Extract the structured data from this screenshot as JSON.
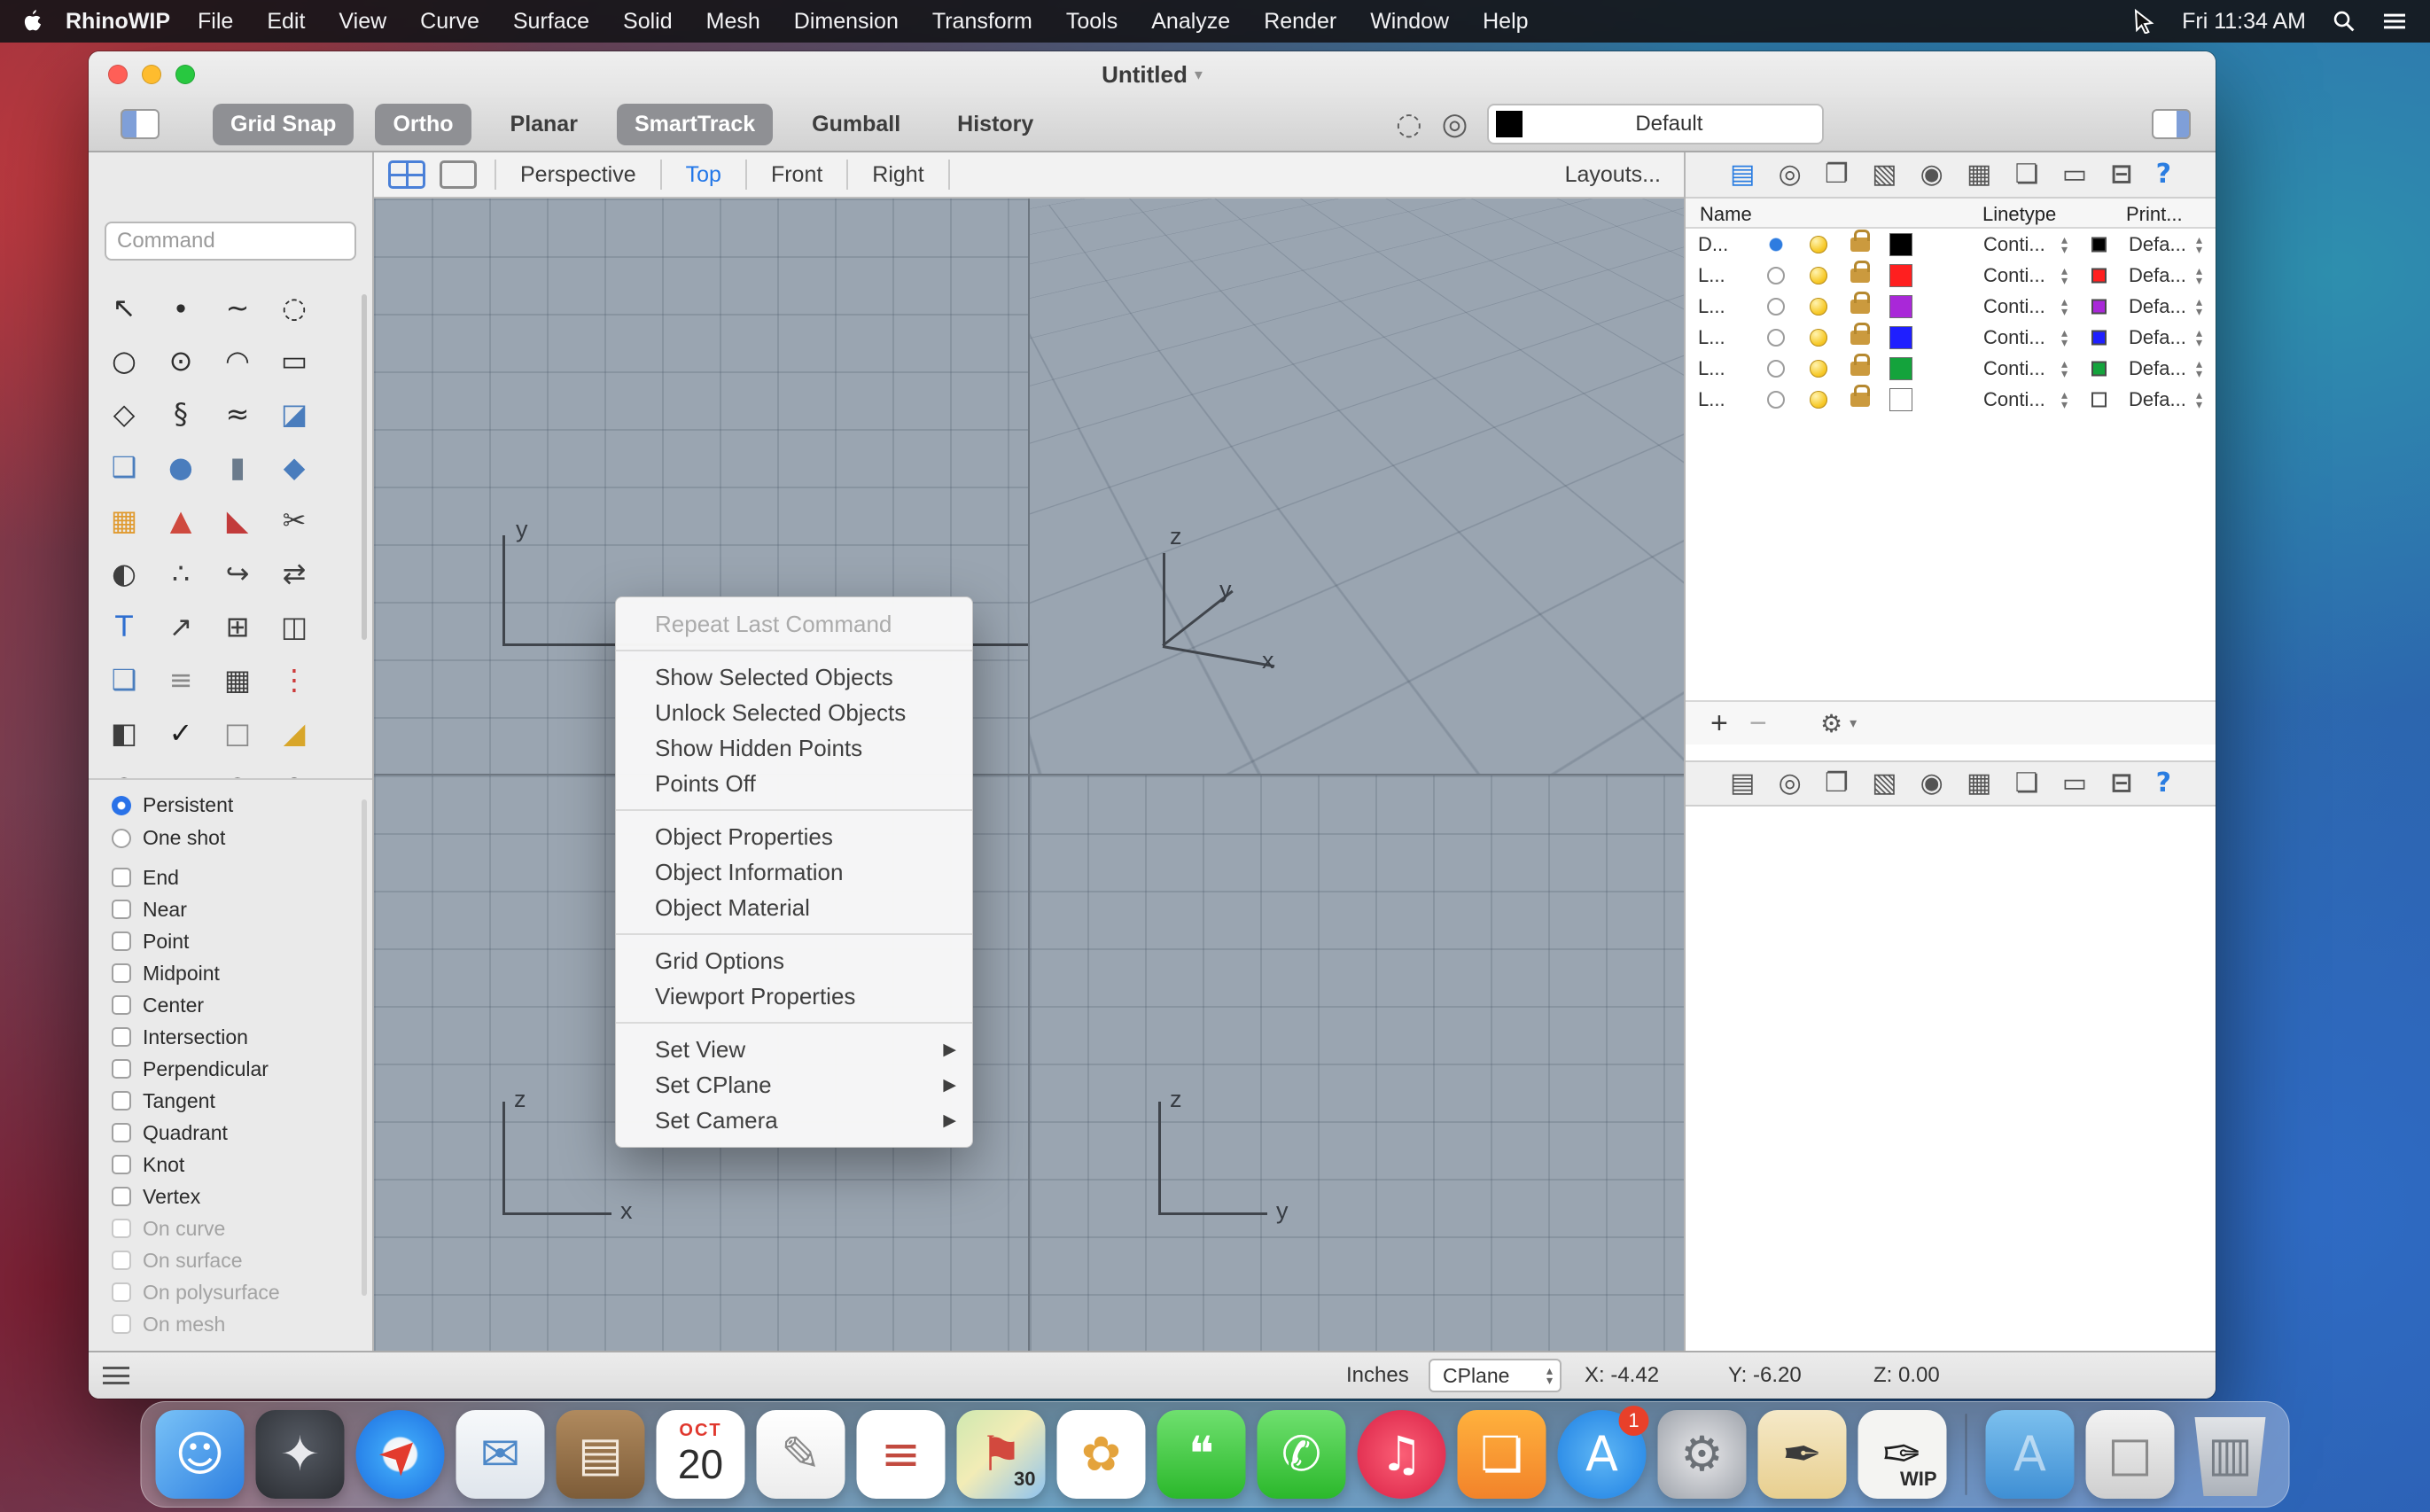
{
  "menubar": {
    "app_name": "RhinoWIP",
    "menus": [
      "File",
      "Edit",
      "View",
      "Curve",
      "Surface",
      "Solid",
      "Mesh",
      "Dimension",
      "Transform",
      "Tools",
      "Analyze",
      "Render",
      "Window",
      "Help"
    ],
    "clock": "Fri 11:34 AM",
    "status_icons": [
      "pointer-icon",
      "spotlight-search-icon",
      "notification-center-icon"
    ]
  },
  "window": {
    "title": "Untitled",
    "title_chevron": "▾",
    "toolbar": {
      "buttons": [
        {
          "label": "Grid Snap",
          "on": true
        },
        {
          "label": "Ortho",
          "on": true
        },
        {
          "label": "Planar",
          "on": false
        },
        {
          "label": "SmartTrack",
          "on": true
        },
        {
          "label": "Gumball",
          "on": false
        },
        {
          "label": "History",
          "on": false
        }
      ],
      "right_icons": [
        {
          "name": "snap-disc-icon",
          "glyph": "◌"
        },
        {
          "name": "target-circle-icon",
          "glyph": "◎"
        }
      ],
      "layer_selector": {
        "value": "Default",
        "swatch": "#000000"
      }
    },
    "viewport_bar": {
      "tabs": [
        {
          "label": "Perspective",
          "active": false
        },
        {
          "label": "Top",
          "active": true
        },
        {
          "label": "Front",
          "active": false
        },
        {
          "label": "Right",
          "active": false
        }
      ],
      "layouts": "Layouts..."
    },
    "sidebar": {
      "command_placeholder": "Command",
      "tools": [
        {
          "name": "select-arrow-tool",
          "glyph": "↖",
          "color": "#2e2e2e"
        },
        {
          "name": "point-tool",
          "glyph": "∙",
          "color": "#2e2e2e"
        },
        {
          "name": "control-point-curve-tool",
          "glyph": "~",
          "color": "#2e2e2e"
        },
        {
          "name": "lasso-tool",
          "glyph": "◌",
          "color": "#2e2e2e"
        },
        {
          "name": "circle-tool",
          "glyph": "○",
          "color": "#2e2e2e"
        },
        {
          "name": "ellipse-tool",
          "glyph": "⊙",
          "color": "#2e2e2e"
        },
        {
          "name": "arc-tool",
          "glyph": "◠",
          "color": "#2e2e2e"
        },
        {
          "name": "rectangle-tool",
          "glyph": "▭",
          "color": "#2e2e2e"
        },
        {
          "name": "polygon-tool",
          "glyph": "◇",
          "color": "#2e2e2e"
        },
        {
          "name": "helix-tool",
          "glyph": "§",
          "color": "#2e2e2e"
        },
        {
          "name": "freeform-curve-tool",
          "glyph": "≈",
          "color": "#2e2e2e"
        },
        {
          "name": "surface-tool",
          "glyph": "◪",
          "color": "#4a7dbd"
        },
        {
          "name": "box-tool",
          "glyph": "❑",
          "color": "#4a7dbd"
        },
        {
          "name": "sphere-tool",
          "glyph": "●",
          "color": "#4a7dbd"
        },
        {
          "name": "cylinder-tool",
          "glyph": "▮",
          "color": "#6b7b8c"
        },
        {
          "name": "plane-tool",
          "glyph": "◆",
          "color": "#4a7dbd"
        },
        {
          "name": "plugins-puzzle-tool",
          "glyph": "▦",
          "color": "#e09a2f"
        },
        {
          "name": "analyze-tool",
          "glyph": "▲",
          "color": "#cf4a3f"
        },
        {
          "name": "fillet-tool",
          "glyph": "◣",
          "color": "#c23b3b"
        },
        {
          "name": "trim-tool",
          "glyph": "✂",
          "color": "#3e3e3e"
        },
        {
          "name": "boolean-tool",
          "glyph": "◐",
          "color": "#3e3e3e"
        },
        {
          "name": "divide-tool",
          "glyph": "∴",
          "color": "#3e3e3e"
        },
        {
          "name": "blend-tool",
          "glyph": "↪",
          "color": "#3e3e3e"
        },
        {
          "name": "orient-tool",
          "glyph": "⇄",
          "color": "#3e3e3e"
        },
        {
          "name": "text-tool",
          "glyph": "T",
          "color": "#2f6fd0"
        },
        {
          "name": "move-tool",
          "glyph": "↗",
          "color": "#3e3e3e"
        },
        {
          "name": "copy-tool",
          "glyph": "⊞",
          "color": "#3e3e3e"
        },
        {
          "name": "mirror-tool",
          "glyph": "◫",
          "color": "#3e3e3e"
        },
        {
          "name": "extrude-tool",
          "glyph": "❑",
          "color": "#4a7dbd"
        },
        {
          "name": "point-grid-tool",
          "glyph": "≡",
          "color": "#8a8a8a"
        },
        {
          "name": "array-tool",
          "glyph": "▦",
          "color": "#3e3e3e"
        },
        {
          "name": "linear-array-tool",
          "glyph": "⋮",
          "color": "#cc3a3a"
        },
        {
          "name": "split-tool",
          "glyph": "◧",
          "color": "#3e3e3e"
        },
        {
          "name": "check-tool",
          "glyph": "✓",
          "color": "#1e1e1e"
        },
        {
          "name": "cage-edit-tool",
          "glyph": "□",
          "color": "#8a8a8a"
        },
        {
          "name": "taper-tool",
          "glyph": "◢",
          "color": "#d8a62a"
        },
        {
          "name": "small-circle-tool",
          "glyph": "○",
          "color": "#3e3e3e"
        },
        {
          "name": "points-rect-tool",
          "glyph": "▫",
          "color": "#8a8a8a"
        },
        {
          "name": "ellipse-center-tool",
          "glyph": "◎",
          "color": "#3e3e3e"
        },
        {
          "name": "blend-curve-tool",
          "glyph": "◌",
          "color": "#3e3e3e"
        }
      ],
      "osnap": {
        "radios": [
          {
            "label": "Persistent",
            "selected": true
          },
          {
            "label": "One shot",
            "selected": false
          }
        ],
        "checkboxes": [
          {
            "label": "End"
          },
          {
            "label": "Near"
          },
          {
            "label": "Point"
          },
          {
            "label": "Midpoint"
          },
          {
            "label": "Center"
          },
          {
            "label": "Intersection"
          },
          {
            "label": "Perpendicular"
          },
          {
            "label": "Tangent"
          },
          {
            "label": "Quadrant"
          },
          {
            "label": "Knot"
          },
          {
            "label": "Vertex"
          },
          {
            "label": "On curve",
            "disabled": true
          },
          {
            "label": "On surface",
            "disabled": true
          },
          {
            "label": "On polysurface",
            "disabled": true
          },
          {
            "label": "On mesh",
            "disabled": true
          }
        ]
      }
    },
    "viewports": {
      "top": {
        "v": "y",
        "h": ""
      },
      "perspective": {
        "up": "z",
        "diag": "y",
        "right": "x"
      },
      "front": {
        "v": "z",
        "h": "x"
      },
      "right": {
        "v": "z",
        "h": "y"
      }
    },
    "context_menu": {
      "items": [
        {
          "label": "Repeat Last Command",
          "disabled": true
        },
        {
          "separator": true
        },
        {
          "label": "Show Selected Objects"
        },
        {
          "label": "Unlock Selected Objects"
        },
        {
          "label": "Show Hidden Points"
        },
        {
          "label": "Points Off"
        },
        {
          "separator": true
        },
        {
          "label": "Object Properties"
        },
        {
          "label": "Object Information"
        },
        {
          "label": "Object Material"
        },
        {
          "separator": true
        },
        {
          "label": "Grid Options"
        },
        {
          "label": "Viewport Properties"
        },
        {
          "separator": true
        },
        {
          "label": "Set View",
          "submenu": true,
          "arrow": "▶"
        },
        {
          "label": "Set CPlane",
          "submenu": true,
          "arrow": "▶"
        },
        {
          "label": "Set Camera",
          "submenu": true,
          "arrow": "▶"
        }
      ]
    },
    "layers_panel": {
      "tabs_top": [
        {
          "name": "layers-tab-icon",
          "glyph": "▤",
          "accent": "#2a7de1"
        },
        {
          "name": "materials-tab-icon",
          "glyph": "◎",
          "accent": "#555555"
        },
        {
          "name": "notes-tab-icon",
          "glyph": "❐",
          "accent": "#555555"
        },
        {
          "name": "display-tab-icon",
          "glyph": "▧",
          "accent": "#555555"
        },
        {
          "name": "named-views-tab-icon",
          "glyph": "◉",
          "accent": "#555555"
        },
        {
          "name": "hatch-tab-icon",
          "glyph": "▦",
          "accent": "#555555"
        },
        {
          "name": "pages-tab-icon",
          "glyph": "❏",
          "accent": "#555555"
        },
        {
          "name": "frame-tab-icon",
          "glyph": "▭",
          "accent": "#555555"
        },
        {
          "name": "display-modes-tab-icon",
          "glyph": "⊟",
          "accent": "#555555"
        },
        {
          "name": "help-tab-icon",
          "glyph": "?",
          "accent": "#2a7de1"
        }
      ],
      "tabs_bottom": [
        {
          "name": "layers-tab-icon",
          "glyph": "▤",
          "accent": "#555555"
        },
        {
          "name": "materials-tab-icon",
          "glyph": "◎",
          "accent": "#555555"
        },
        {
          "name": "notes-tab-icon",
          "glyph": "❐",
          "accent": "#555555"
        },
        {
          "name": "display-tab-icon",
          "glyph": "▧",
          "accent": "#555555"
        },
        {
          "name": "named-views-tab-icon",
          "glyph": "◉",
          "accent": "#555555"
        },
        {
          "name": "hatch-tab-icon",
          "glyph": "▦",
          "accent": "#555555"
        },
        {
          "name": "pages-tab-icon",
          "glyph": "❏",
          "accent": "#555555"
        },
        {
          "name": "frame-tab-icon",
          "glyph": "▭",
          "accent": "#555555"
        },
        {
          "name": "display-modes-tab-icon",
          "glyph": "⊟",
          "accent": "#555555"
        },
        {
          "name": "help-tab-icon",
          "glyph": "?",
          "accent": "#2a7de1"
        }
      ],
      "columns": [
        "Name",
        "Linetype",
        "Print..."
      ],
      "rows": [
        {
          "name": "D...",
          "current": true,
          "color": "#000000",
          "linetype": "Conti...",
          "print_color": "#000000",
          "print": "Defa..."
        },
        {
          "name": "L...",
          "current": false,
          "color": "#ff1f1f",
          "linetype": "Conti...",
          "print_color": "#ff1f1f",
          "print": "Defa..."
        },
        {
          "name": "L...",
          "current": false,
          "color": "#a928d8",
          "linetype": "Conti...",
          "print_color": "#a928d8",
          "print": "Defa..."
        },
        {
          "name": "L...",
          "current": false,
          "color": "#1f1fff",
          "linetype": "Conti...",
          "print_color": "#1f1fff",
          "print": "Defa..."
        },
        {
          "name": "L...",
          "current": false,
          "color": "#14a33c",
          "linetype": "Conti...",
          "print_color": "#14a33c",
          "print": "Defa..."
        },
        {
          "name": "L...",
          "current": false,
          "color": "#ffffff",
          "linetype": "Conti...",
          "print_color": "#ffffff",
          "print": "Defa..."
        }
      ],
      "footer": {
        "add": "+",
        "remove": "−",
        "gear": "⚙",
        "chevron": "▾"
      }
    },
    "status_bar": {
      "units": "Inches",
      "cplane": "CPlane",
      "x": "X: -4.42",
      "y": "Y: -6.20",
      "z": "Z: 0.00"
    }
  },
  "dock": {
    "items": [
      {
        "name": "finder",
        "bg": "linear-gradient(135deg,#79c2f7 0%,#2d7fe0 100%)",
        "glyph": "☺",
        "gc": "#ffffff"
      },
      {
        "name": "launchpad",
        "bg": "radial-gradient(circle at 50% 40%, #555a63, #2b2e33)",
        "glyph": "✦",
        "gc": "#e8e8ec"
      },
      {
        "name": "safari",
        "bg": "radial-gradient(circle,#ffffff 0%,#eef3f8 26%,#3aa0f5 29%,#1b6ce0 100%)",
        "glyph": "➤",
        "gc": "#e33b2e",
        "round": true
      },
      {
        "name": "mail",
        "bg": "linear-gradient(180deg,#f7f9fb,#dfe5ec)",
        "glyph": "✉",
        "gc": "#4d88c8"
      },
      {
        "name": "contacts",
        "bg": "linear-gradient(180deg,#b08a5e,#7d5c38)",
        "glyph": "▤",
        "gc": "#f3e9dc"
      },
      {
        "name": "calendar",
        "bg": "#ffffff",
        "cal_month": "OCT",
        "cal_day": "20"
      },
      {
        "name": "textedit",
        "bg": "linear-gradient(180deg,#ffffff,#ececec)",
        "glyph": "✎",
        "gc": "#8a8a8a"
      },
      {
        "name": "reminders",
        "bg": "#ffffff",
        "glyph": "≡",
        "gc": "#c24a3f"
      },
      {
        "name": "maps",
        "bg": "linear-gradient(135deg,#cfe8b0 0%,#f2ecb6 45%,#8fc3ef 100%)",
        "glyph": "⚑",
        "gc": "#d2493e",
        "overlay": "30"
      },
      {
        "name": "photos",
        "bg": "#ffffff",
        "glyph": "✿",
        "gc": "#e4a33c"
      },
      {
        "name": "messages",
        "bg": "linear-gradient(180deg,#6fe06f,#2bb82b)",
        "glyph": "❝",
        "gc": "#ffffff"
      },
      {
        "name": "facetime",
        "bg": "linear-gradient(180deg,#6fe06f,#2bb82b)",
        "glyph": "✆",
        "gc": "#ffffff"
      },
      {
        "name": "itunes",
        "bg": "radial-gradient(circle,#fb5f76,#d92045)",
        "glyph": "♫",
        "gc": "#ffffff",
        "round": true
      },
      {
        "name": "ibooks",
        "bg": "linear-gradient(180deg,#ffb13d,#f2832a)",
        "glyph": "❏",
        "gc": "#ffffff"
      },
      {
        "name": "app-store",
        "bg": "radial-gradient(circle,#5fb7f5,#1d7fe3)",
        "glyph": "A",
        "gc": "#ffffff",
        "round": true,
        "badge": "1"
      },
      {
        "name": "system-preferences",
        "bg": "radial-gradient(circle,#e8e8ea,#9ea3ab)",
        "glyph": "⚙",
        "gc": "#6b7076"
      },
      {
        "name": "graphics-app",
        "bg": "linear-gradient(180deg,#f5e9c8,#e8cf8f)",
        "glyph": "✒",
        "gc": "#3b3b3b"
      },
      {
        "name": "rhino-wip",
        "bg": "#f4f4f2",
        "glyph": "✑",
        "gc": "#1f1f1f",
        "overlay": "WIP"
      },
      {
        "name": "dock-separator",
        "separator": true
      },
      {
        "name": "applications-folder",
        "bg": "linear-gradient(180deg,#7cc0ee,#3f8fd4)",
        "glyph": "A",
        "gc": "rgba(255,255,255,0.55)"
      },
      {
        "name": "utility-app",
        "bg": "linear-gradient(180deg,#f2f2f2,#cfcfcf)",
        "glyph": "□",
        "gc": "#8a8a8a"
      },
      {
        "name": "trash",
        "bg": "linear-gradient(180deg,#e6e8eb,#aab0b8)",
        "glyph": "▥",
        "gc": "#777e86",
        "trash": true
      }
    ]
  }
}
